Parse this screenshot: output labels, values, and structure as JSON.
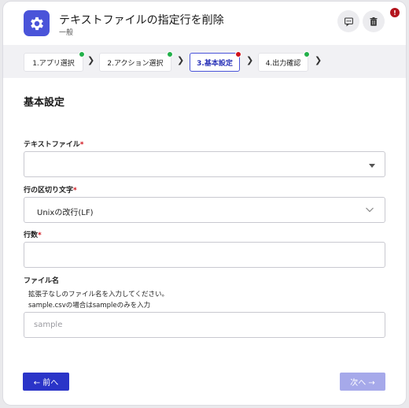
{
  "header": {
    "title": "テキストファイルの指定行を削除",
    "subtitle": "一般",
    "icon": "gear-icon",
    "comment_icon": "comment-icon",
    "trash_icon": "trash-icon",
    "alert_count": "!"
  },
  "steps": [
    {
      "label": "1.アプリ選択",
      "status": "complete",
      "color": "#22b04a"
    },
    {
      "label": "2.アクション選択",
      "status": "complete",
      "color": "#22b04a"
    },
    {
      "label": "3.基本設定",
      "status": "error",
      "color": "#d0121b"
    },
    {
      "label": "4.出力確認",
      "status": "complete",
      "color": "#22b04a"
    }
  ],
  "section": {
    "title": "基本設定"
  },
  "fields": {
    "text_file": {
      "label": "テキストファイル",
      "required": "*",
      "value": ""
    },
    "delimiter": {
      "label": "行の区切り文字",
      "required": "*",
      "value": "Unixの改行(LF)"
    },
    "line_count": {
      "label": "行数",
      "required": "*",
      "value": ""
    },
    "filename": {
      "label": "ファイル名",
      "hint_line1": "拡張子なしのファイル名を入力してください。",
      "hint_line2": "sample.csvの場合はsampleのみを入力",
      "placeholder": "sample",
      "value": ""
    }
  },
  "buttons": {
    "prev": "← 前へ",
    "next": "次へ →"
  },
  "colors": {
    "accent": "#4a54d9",
    "primary_button": "#2a34c8",
    "disabled_button": "#a6a9ea",
    "error": "#d0121b",
    "success": "#22b04a"
  }
}
